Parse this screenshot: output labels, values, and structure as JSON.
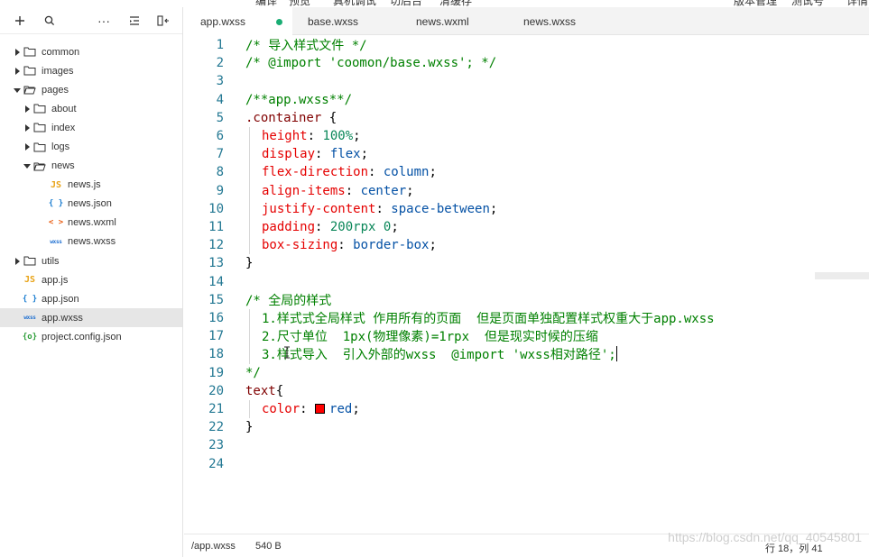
{
  "top_menu": [
    "编译",
    "预览",
    "真机调试",
    "切后台",
    "清缓存",
    "版本管理",
    "测试号",
    "详情"
  ],
  "sidebar": {
    "toolbar": {
      "add": "+",
      "search": "search",
      "more": "···",
      "collapse": "collapse",
      "split": "split"
    },
    "tree": [
      {
        "name": "common",
        "type": "folder",
        "depth": 0,
        "open": false
      },
      {
        "name": "images",
        "type": "folder",
        "depth": 0,
        "open": false
      },
      {
        "name": "pages",
        "type": "folder",
        "depth": 0,
        "open": true
      },
      {
        "name": "about",
        "type": "folder",
        "depth": 1,
        "open": false
      },
      {
        "name": "index",
        "type": "folder",
        "depth": 1,
        "open": false
      },
      {
        "name": "logs",
        "type": "folder",
        "depth": 1,
        "open": false
      },
      {
        "name": "news",
        "type": "folder",
        "depth": 1,
        "open": true
      },
      {
        "name": "news.js",
        "type": "js",
        "depth": 2
      },
      {
        "name": "news.json",
        "type": "json",
        "depth": 2
      },
      {
        "name": "news.wxml",
        "type": "wxml",
        "depth": 2
      },
      {
        "name": "news.wxss",
        "type": "wxss",
        "depth": 2
      },
      {
        "name": "utils",
        "type": "folder",
        "depth": 0,
        "open": false
      },
      {
        "name": "app.js",
        "type": "js",
        "depth": 0
      },
      {
        "name": "app.json",
        "type": "json",
        "depth": 0
      },
      {
        "name": "app.wxss",
        "type": "wxss",
        "depth": 0,
        "selected": true
      },
      {
        "name": "project.config.json",
        "type": "cfg",
        "depth": 0
      }
    ],
    "icons": {
      "js": "JS",
      "json": "{ }",
      "wxml": "< >",
      "wxss": "wxss",
      "cfg": "{o}"
    }
  },
  "tabs": [
    {
      "label": "app.wxss",
      "active": true,
      "modified": true
    },
    {
      "label": "base.wxss",
      "active": false
    },
    {
      "label": "news.wxml",
      "active": false
    },
    {
      "label": "news.wxss",
      "active": false
    }
  ],
  "editor": {
    "lines": [
      {
        "n": "1",
        "t": [
          [
            "c-comment",
            "/* 导入样式文件 */"
          ]
        ]
      },
      {
        "n": "2",
        "t": [
          [
            "c-comment",
            "/* @import 'coomon/base.wxss'; */"
          ]
        ]
      },
      {
        "n": "3",
        "t": []
      },
      {
        "n": "4",
        "t": [
          [
            "c-comment",
            "/**app.wxss**/"
          ]
        ]
      },
      {
        "n": "5",
        "t": [
          [
            "c-sel",
            ".container"
          ],
          [
            "c-plain",
            " {"
          ]
        ]
      },
      {
        "n": "6",
        "g": 1,
        "t": [
          [
            "c-prop",
            "height"
          ],
          [
            "c-plain",
            ": "
          ],
          [
            "c-num",
            "100%"
          ],
          [
            "c-plain",
            ";"
          ]
        ]
      },
      {
        "n": "7",
        "g": 1,
        "t": [
          [
            "c-prop",
            "display"
          ],
          [
            "c-plain",
            ": "
          ],
          [
            "c-val",
            "flex"
          ],
          [
            "c-plain",
            ";"
          ]
        ]
      },
      {
        "n": "8",
        "g": 1,
        "t": [
          [
            "c-prop",
            "flex-direction"
          ],
          [
            "c-plain",
            ": "
          ],
          [
            "c-val",
            "column"
          ],
          [
            "c-plain",
            ";"
          ]
        ]
      },
      {
        "n": "9",
        "g": 1,
        "t": [
          [
            "c-prop",
            "align-items"
          ],
          [
            "c-plain",
            ": "
          ],
          [
            "c-val",
            "center"
          ],
          [
            "c-plain",
            ";"
          ]
        ]
      },
      {
        "n": "10",
        "g": 1,
        "t": [
          [
            "c-prop",
            "justify-content"
          ],
          [
            "c-plain",
            ": "
          ],
          [
            "c-val",
            "space-between"
          ],
          [
            "c-plain",
            ";"
          ]
        ]
      },
      {
        "n": "11",
        "g": 1,
        "t": [
          [
            "c-prop",
            "padding"
          ],
          [
            "c-plain",
            ": "
          ],
          [
            "c-num",
            "200rpx 0"
          ],
          [
            "c-plain",
            ";"
          ]
        ]
      },
      {
        "n": "12",
        "g": 1,
        "t": [
          [
            "c-prop",
            "box-sizing"
          ],
          [
            "c-plain",
            ": "
          ],
          [
            "c-val",
            "border-box"
          ],
          [
            "c-plain",
            ";"
          ]
        ]
      },
      {
        "n": "13",
        "t": [
          [
            "c-plain",
            "}"
          ]
        ]
      },
      {
        "n": "14",
        "t": []
      },
      {
        "n": "15",
        "t": [
          [
            "c-comment",
            "/* 全局的样式"
          ]
        ]
      },
      {
        "n": "16",
        "g": 1,
        "t": [
          [
            "c-comment",
            "1.样式式全局样式 作用所有的页面  但是页面单独配置样式权重大于app.wxss"
          ]
        ]
      },
      {
        "n": "17",
        "g": 1,
        "t": [
          [
            "c-comment",
            "2.尺寸单位  1px(物理像素)=1rpx  但是现实时候的压缩"
          ]
        ]
      },
      {
        "n": "18",
        "g": 1,
        "caret": true,
        "t": [
          [
            "c-comment",
            "3.样式导入  引入外部的wxss  @import 'wxss相对路径';"
          ]
        ]
      },
      {
        "n": "19",
        "t": [
          [
            "c-comment",
            "*/"
          ]
        ]
      },
      {
        "n": "20",
        "t": [
          [
            "c-sel",
            "text"
          ],
          [
            "c-plain",
            "{"
          ]
        ]
      },
      {
        "n": "21",
        "g": 1,
        "swatch": true,
        "t": [
          [
            "c-prop",
            "color"
          ],
          [
            "c-plain",
            ": "
          ],
          [
            "c-val",
            "red"
          ],
          [
            "c-plain",
            ";"
          ]
        ]
      },
      {
        "n": "22",
        "t": [
          [
            "c-plain",
            "}"
          ]
        ]
      },
      {
        "n": "23",
        "t": []
      },
      {
        "n": "24",
        "t": []
      }
    ],
    "cursor_icon": "text-cursor-icon"
  },
  "status": {
    "path": "/app.wxss",
    "size": "540 B",
    "position": "行 18，列 41"
  },
  "watermark": "https://blog.csdn.net/qq_40545801",
  "colors": {
    "tab_dot": "#1aad74",
    "swatch_red": "#ff0000",
    "line_number": "#237893"
  }
}
